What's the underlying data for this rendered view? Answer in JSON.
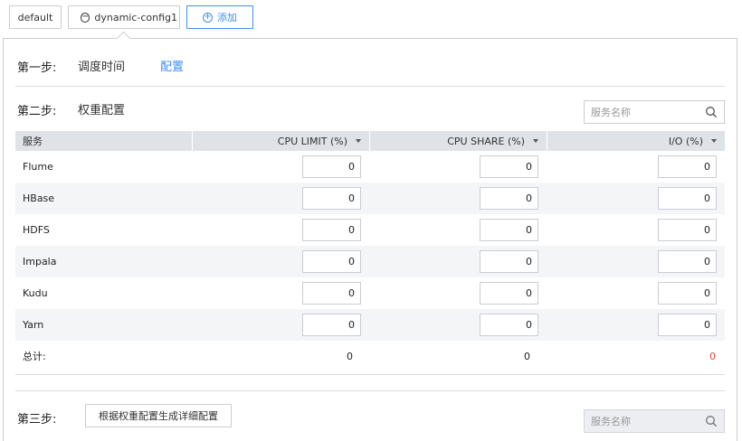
{
  "tabs": {
    "default_label": "default",
    "config_label": "dynamic-config1",
    "add_label": "添加"
  },
  "step1": {
    "label": "第一步:",
    "value": "调度时间",
    "link": "配置"
  },
  "step2": {
    "label": "第二步:",
    "value": "权重配置",
    "search_placeholder": "服务名称",
    "columns": [
      "服务",
      "CPU LIMIT (%)",
      "CPU SHARE (%)",
      "I/O (%)"
    ],
    "rows": [
      {
        "service": "Flume",
        "cpu_limit": "0",
        "cpu_share": "0",
        "io": "0"
      },
      {
        "service": "HBase",
        "cpu_limit": "0",
        "cpu_share": "0",
        "io": "0"
      },
      {
        "service": "HDFS",
        "cpu_limit": "0",
        "cpu_share": "0",
        "io": "0"
      },
      {
        "service": "Impala",
        "cpu_limit": "0",
        "cpu_share": "0",
        "io": "0"
      },
      {
        "service": "Kudu",
        "cpu_limit": "0",
        "cpu_share": "0",
        "io": "0"
      },
      {
        "service": "Yarn",
        "cpu_limit": "0",
        "cpu_share": "0",
        "io": "0"
      }
    ],
    "total": {
      "label": "总计:",
      "cpu_limit": "0",
      "cpu_share": "0",
      "io": "0"
    }
  },
  "step3": {
    "label": "第三步:",
    "button": "根据权重配置生成详细配置",
    "search_placeholder": "服务名称"
  },
  "colors": {
    "accent": "#3e8ef7",
    "total_io": "#e64545",
    "header_bg": "#dfe3e8",
    "alt_row": "#f4f5f7"
  },
  "icons": {
    "remove": "minus-circle-icon",
    "add": "plus-circle-icon",
    "search": "search-icon",
    "sort": "caret-down-icon"
  }
}
